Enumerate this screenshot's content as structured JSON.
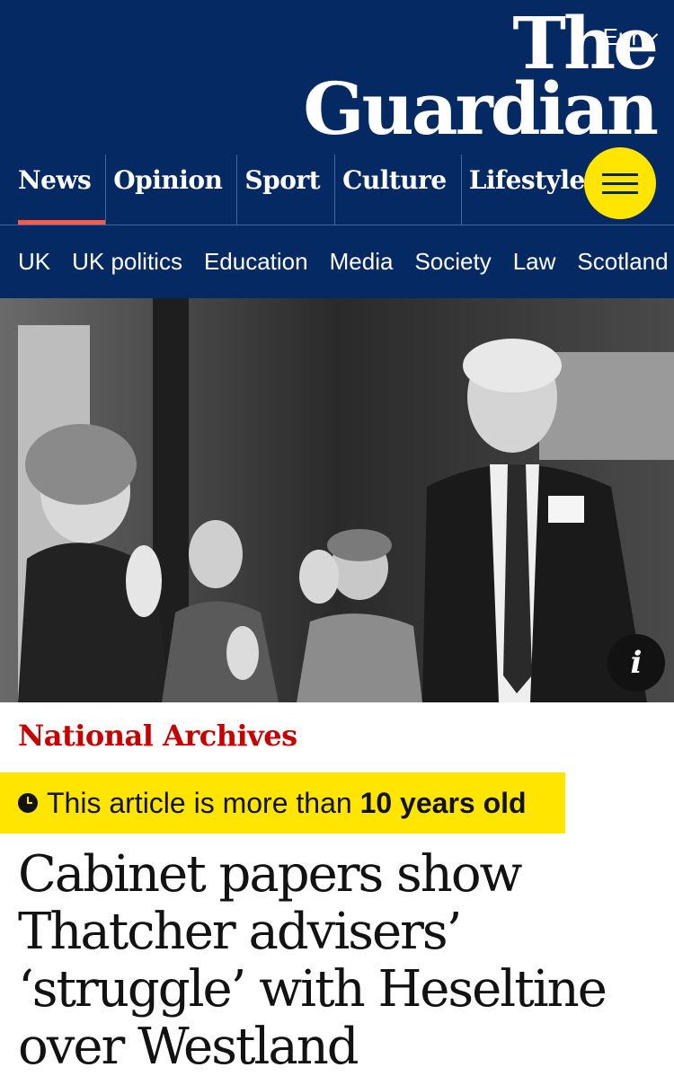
{
  "header": {
    "edition": "Eur",
    "logo_line1": "The",
    "logo_line2": "Guardian",
    "menu_label": "Menu"
  },
  "pillars": [
    {
      "label": "News",
      "active": true
    },
    {
      "label": "Opinion"
    },
    {
      "label": "Sport"
    },
    {
      "label": "Culture"
    },
    {
      "label": "Lifestyle"
    }
  ],
  "subnav": [
    "UK",
    "UK politics",
    "Education",
    "Media",
    "Society",
    "Law",
    "Scotland"
  ],
  "article": {
    "kicker": "National Archives",
    "age_warning_prefix": "This article is more than ",
    "age_warning_bold": "10 years old",
    "headline": "Cabinet papers show Thatcher advisers’ ‘struggle’ with Heseltine over Westland"
  },
  "icons": {
    "edition_chevron": "chevron-down-icon",
    "menu": "hamburger-icon",
    "info": "info-icon",
    "clock": "clock-icon"
  },
  "colors": {
    "brand_blue": "#052962",
    "menu_yellow": "#ffe500",
    "news_red": "#ff5943",
    "kicker_red": "#c70000",
    "warning_yellow": "#ffe500"
  }
}
